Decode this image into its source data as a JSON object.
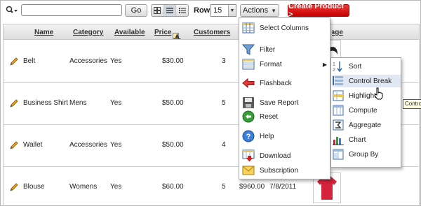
{
  "toolbar": {
    "search_value": "",
    "go_label": "Go",
    "rows_label": "Rows",
    "rows_value": "15",
    "actions_label": "Actions",
    "create_label": "Create Product >"
  },
  "table": {
    "headers": [
      "Name",
      "Category",
      "Available",
      "Price",
      "Customers",
      "Image"
    ],
    "rows": [
      {
        "name": "Belt",
        "category": "Accessories",
        "available": "Yes",
        "price": "$30.00",
        "customers": "3",
        "col6": "",
        "col7": ""
      },
      {
        "name": "Business Shirt",
        "category": "Mens",
        "available": "Yes",
        "price": "$50.00",
        "customers": "5",
        "col6": "$",
        "col7": ""
      },
      {
        "name": "Wallet",
        "category": "Accessories",
        "available": "Yes",
        "price": "$50.00",
        "customers": "4",
        "col6": "",
        "col7": ""
      },
      {
        "name": "Blouse",
        "category": "Womens",
        "available": "Yes",
        "price": "$60.00",
        "customers": "5",
        "col6": "$960.00",
        "col7": "7/8/2011"
      }
    ]
  },
  "actions_menu": {
    "items": [
      {
        "label": "Select Columns",
        "icon": "select-columns-icon"
      },
      {
        "label": "Filter",
        "icon": "filter-icon"
      },
      {
        "label": "Format",
        "icon": "format-icon"
      },
      {
        "label": "Flashback",
        "icon": "flashback-icon"
      },
      {
        "label": "Save Report",
        "icon": "save-icon"
      },
      {
        "label": "Reset",
        "icon": "reset-icon"
      },
      {
        "label": "Help",
        "icon": "help-icon"
      },
      {
        "label": "Download",
        "icon": "download-icon"
      },
      {
        "label": "Subscription",
        "icon": "subscription-icon"
      }
    ]
  },
  "format_submenu": {
    "items": [
      {
        "label": "Sort",
        "icon": "sort-icon"
      },
      {
        "label": "Control Break",
        "icon": "control-break-icon"
      },
      {
        "label": "Highlight",
        "icon": "highlight-icon"
      },
      {
        "label": "Compute",
        "icon": "compute-icon"
      },
      {
        "label": "Aggregate",
        "icon": "aggregate-icon"
      },
      {
        "label": "Chart",
        "icon": "chart-icon"
      },
      {
        "label": "Group By",
        "icon": "group-by-icon"
      }
    ]
  },
  "tooltip": "Control Break",
  "colors": {
    "create_button": "#d40000",
    "menu_highlight": "#dde7f5",
    "header_bg": "#e6e6e6"
  }
}
